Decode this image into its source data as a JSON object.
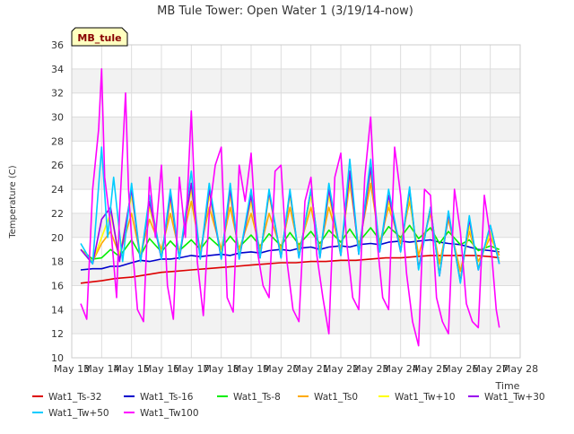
{
  "chart_data": {
    "type": "line",
    "title": "MB Tule Tower: Open Water 1 (3/19/14-now)",
    "xlabel": "Time",
    "ylabel": "Temperature (C)",
    "badge": "MB_tule",
    "xlim": [
      13,
      28
    ],
    "ylim": [
      10,
      36
    ],
    "x_ticks": [
      13,
      14,
      15,
      16,
      17,
      18,
      19,
      20,
      21,
      22,
      23,
      24,
      25,
      26,
      27,
      28
    ],
    "x_tick_labels": [
      "May 13",
      "May 14",
      "May 15",
      "May 16",
      "May 17",
      "May 18",
      "May 19",
      "May 20",
      "May 21",
      "May 22",
      "May 23",
      "May 24",
      "May 25",
      "May 26",
      "May 27",
      "May 28"
    ],
    "y_ticks": [
      10,
      12,
      14,
      16,
      18,
      20,
      22,
      24,
      26,
      28,
      30,
      32,
      34,
      36
    ],
    "grid": true,
    "legend_position": "bottom",
    "series": [
      {
        "name": "Wat1_Ts-32",
        "color": "#dd0000",
        "x": [
          13.3,
          14,
          14.5,
          15,
          15.5,
          16,
          16.5,
          17,
          17.5,
          18,
          18.5,
          19,
          19.5,
          20,
          20.5,
          21,
          21.5,
          22,
          22.5,
          23,
          23.5,
          24,
          24.5,
          25,
          25.5,
          26,
          26.5,
          27,
          27.3
        ],
        "y": [
          16.2,
          16.4,
          16.6,
          16.7,
          16.9,
          17.1,
          17.2,
          17.3,
          17.4,
          17.5,
          17.6,
          17.7,
          17.8,
          17.9,
          17.9,
          18.0,
          18.0,
          18.1,
          18.1,
          18.2,
          18.3,
          18.3,
          18.4,
          18.5,
          18.5,
          18.5,
          18.5,
          18.4,
          18.3
        ]
      },
      {
        "name": "Wat1_Ts-16",
        "color": "#0000cc",
        "x": [
          13.3,
          13.7,
          14,
          14.3,
          14.6,
          15,
          15.3,
          15.6,
          16,
          16.3,
          16.6,
          17,
          17.3,
          17.6,
          18,
          18.3,
          18.6,
          19,
          19.3,
          19.6,
          20,
          20.3,
          20.6,
          21,
          21.3,
          21.6,
          22,
          22.3,
          22.6,
          23,
          23.3,
          23.6,
          24,
          24.3,
          24.6,
          25,
          25.3,
          25.6,
          26,
          26.3,
          26.6,
          27,
          27.3
        ],
        "y": [
          17.3,
          17.4,
          17.4,
          17.6,
          17.6,
          17.9,
          18.1,
          18.0,
          18.2,
          18.2,
          18.3,
          18.5,
          18.4,
          18.5,
          18.6,
          18.5,
          18.7,
          18.8,
          18.7,
          18.9,
          19.0,
          18.9,
          19.1,
          19.2,
          19.0,
          19.2,
          19.3,
          19.2,
          19.4,
          19.5,
          19.4,
          19.6,
          19.7,
          19.6,
          19.7,
          19.8,
          19.6,
          19.5,
          19.4,
          19.2,
          19.0,
          18.9,
          18.8
        ]
      },
      {
        "name": "Wat1_Ts-8",
        "color": "#00ee00",
        "x": [
          13.3,
          13.7,
          14,
          14.3,
          14.6,
          15,
          15.3,
          15.6,
          16,
          16.3,
          16.6,
          17,
          17.3,
          17.6,
          18,
          18.3,
          18.6,
          19,
          19.3,
          19.6,
          20,
          20.3,
          20.6,
          21,
          21.3,
          21.6,
          22,
          22.3,
          22.6,
          23,
          23.3,
          23.6,
          24,
          24.3,
          24.6,
          25,
          25.3,
          25.6,
          26,
          26.3,
          26.6,
          27,
          27.3
        ],
        "y": [
          19.0,
          18.2,
          18.3,
          19.0,
          18.4,
          19.8,
          18.5,
          19.9,
          18.8,
          19.7,
          18.9,
          19.8,
          19.0,
          20.0,
          19.1,
          20.1,
          19.2,
          20.2,
          19.3,
          20.3,
          19.3,
          20.4,
          19.4,
          20.5,
          19.5,
          20.6,
          19.6,
          20.7,
          19.6,
          20.8,
          19.8,
          20.9,
          20.0,
          21.0,
          19.9,
          20.8,
          19.5,
          20.5,
          19.4,
          19.8,
          18.9,
          19.3,
          19.0
        ]
      },
      {
        "name": "Wat1_Ts0",
        "color": "#ffaa00",
        "x": [
          13.3,
          13.7,
          14,
          14.3,
          14.6,
          15,
          15.3,
          15.6,
          16,
          16.3,
          16.6,
          17,
          17.3,
          17.6,
          18,
          18.3,
          18.6,
          19,
          19.3,
          19.6,
          20,
          20.3,
          20.6,
          21,
          21.3,
          21.6,
          22,
          22.3,
          22.6,
          23,
          23.3,
          23.6,
          24,
          24.3,
          24.6,
          25,
          25.3,
          25.6,
          26,
          26.3,
          26.6,
          27,
          27.3
        ],
        "y": [
          19.0,
          18.0,
          19.5,
          20.5,
          18.5,
          22.0,
          18.5,
          21.5,
          19.0,
          22.0,
          18.8,
          23.0,
          19.0,
          22.5,
          19.0,
          22.5,
          19.0,
          22.0,
          19.0,
          22.0,
          19.0,
          22.5,
          19.0,
          22.5,
          19.0,
          22.5,
          19.0,
          24.5,
          19.2,
          24.5,
          19.5,
          22.5,
          19.5,
          23.0,
          18.5,
          22.0,
          17.8,
          21.5,
          17.2,
          20.5,
          18.0,
          20.0,
          18.5
        ]
      },
      {
        "name": "Wat1_Tw+10",
        "color": "#ffff00",
        "x": [
          13.3,
          13.7,
          14,
          14.3,
          14.6,
          15,
          15.3,
          15.6,
          16,
          16.3,
          16.6,
          17,
          17.3,
          17.6,
          18,
          18.3,
          18.6,
          19,
          19.3,
          19.6,
          20,
          20.3,
          20.6,
          21,
          21.3,
          21.6,
          22,
          22.3,
          22.6,
          23,
          23.3,
          23.6,
          24,
          24.3,
          24.6,
          25,
          25.3,
          25.6,
          26,
          26.3,
          26.6,
          27,
          27.3
        ],
        "y": [
          19.0,
          18.0,
          20.0,
          22.0,
          18.5,
          23.5,
          18.5,
          22.5,
          18.5,
          23.0,
          18.5,
          24.0,
          18.5,
          23.5,
          18.5,
          23.5,
          18.5,
          23.0,
          18.5,
          23.5,
          18.5,
          23.5,
          18.5,
          23.5,
          18.5,
          23.5,
          18.5,
          25.0,
          18.8,
          25.5,
          19.0,
          23.0,
          19.0,
          23.5,
          17.5,
          22.5,
          17.0,
          22.0,
          16.5,
          21.0,
          17.5,
          20.5,
          18.0
        ]
      },
      {
        "name": "Wat1_Tw+30",
        "color": "#9900ee",
        "x": [
          13.3,
          13.7,
          14,
          14.3,
          14.6,
          15,
          15.3,
          15.6,
          16,
          16.3,
          16.6,
          17,
          17.3,
          17.6,
          18,
          18.3,
          18.6,
          19,
          19.3,
          19.6,
          20,
          20.3,
          20.6,
          21,
          21.3,
          21.6,
          22,
          22.3,
          22.6,
          23,
          23.3,
          23.6,
          24,
          24.3,
          24.6,
          25,
          25.3,
          25.6,
          26,
          26.3,
          26.6,
          27,
          27.3
        ],
        "y": [
          19.0,
          17.8,
          21.5,
          22.5,
          18.0,
          24.0,
          18.0,
          23.0,
          18.2,
          23.5,
          18.2,
          24.5,
          18.2,
          24.0,
          18.2,
          24.0,
          18.2,
          23.5,
          18.3,
          23.8,
          18.3,
          23.8,
          18.3,
          24.0,
          18.3,
          24.0,
          18.5,
          25.5,
          18.6,
          25.8,
          18.8,
          23.5,
          18.8,
          24.0,
          17.4,
          22.5,
          16.8,
          22.0,
          16.3,
          21.5,
          17.3,
          21.0,
          17.8
        ]
      },
      {
        "name": "Wat1_Tw+50",
        "color": "#00ccff",
        "x": [
          13.3,
          13.7,
          14,
          14.2,
          14.4,
          14.7,
          15,
          15.3,
          15.6,
          16,
          16.3,
          16.6,
          17,
          17.3,
          17.6,
          18,
          18.3,
          18.6,
          19,
          19.3,
          19.6,
          20,
          20.3,
          20.6,
          21,
          21.3,
          21.6,
          22,
          22.3,
          22.6,
          23,
          23.3,
          23.6,
          24,
          24.3,
          24.6,
          25,
          25.3,
          25.6,
          26,
          26.3,
          26.6,
          27,
          27.3
        ],
        "y": [
          19.5,
          17.8,
          27.5,
          20.0,
          25.0,
          18.0,
          24.5,
          18.0,
          23.5,
          18.2,
          24.0,
          18.2,
          25.5,
          18.2,
          24.5,
          18.2,
          24.5,
          18.2,
          24.0,
          18.3,
          24.0,
          18.3,
          24.0,
          18.3,
          24.0,
          18.3,
          24.5,
          18.5,
          26.5,
          18.6,
          26.5,
          18.8,
          24.0,
          18.8,
          24.2,
          17.3,
          22.5,
          16.8,
          22.2,
          16.2,
          21.8,
          17.3,
          21.0,
          17.8
        ]
      },
      {
        "name": "Wat1_Tw100",
        "color": "#ff00ff",
        "x": [
          13.3,
          13.5,
          13.7,
          13.9,
          14.0,
          14.1,
          14.3,
          14.5,
          14.6,
          14.8,
          14.9,
          15.0,
          15.2,
          15.4,
          15.6,
          15.8,
          16.0,
          16.2,
          16.4,
          16.6,
          16.8,
          17.0,
          17.2,
          17.4,
          17.6,
          17.8,
          18.0,
          18.2,
          18.4,
          18.6,
          18.8,
          19.0,
          19.2,
          19.4,
          19.6,
          19.8,
          20.0,
          20.2,
          20.4,
          20.6,
          20.8,
          21.0,
          21.2,
          21.4,
          21.6,
          21.8,
          22.0,
          22.2,
          22.4,
          22.6,
          22.8,
          23.0,
          23.2,
          23.4,
          23.6,
          23.8,
          24.0,
          24.2,
          24.4,
          24.6,
          24.8,
          25.0,
          25.2,
          25.4,
          25.6,
          25.8,
          26.0,
          26.2,
          26.4,
          26.6,
          26.8,
          27.0,
          27.2,
          27.3
        ],
        "y": [
          14.5,
          13.2,
          24.0,
          29.0,
          34.0,
          25.0,
          21.0,
          15.0,
          22.0,
          32.0,
          24.0,
          20.0,
          14.0,
          13.0,
          25.0,
          20.0,
          26.0,
          16.0,
          13.2,
          25.0,
          20.0,
          30.5,
          18.0,
          13.5,
          22.0,
          26.0,
          27.5,
          15.0,
          13.8,
          26.0,
          23.0,
          27.0,
          19.0,
          16.0,
          15.0,
          25.5,
          26.0,
          18.0,
          14.0,
          13.0,
          23.0,
          25.0,
          18.5,
          15.0,
          12.0,
          25.0,
          27.0,
          19.5,
          15.0,
          14.0,
          25.0,
          30.0,
          20.0,
          15.0,
          14.0,
          27.5,
          23.5,
          17.0,
          13.0,
          11.0,
          24.0,
          23.5,
          15.0,
          13.0,
          12.0,
          24.0,
          20.5,
          14.5,
          13.0,
          12.5,
          23.5,
          20.0,
          14.0,
          12.5
        ]
      }
    ]
  }
}
